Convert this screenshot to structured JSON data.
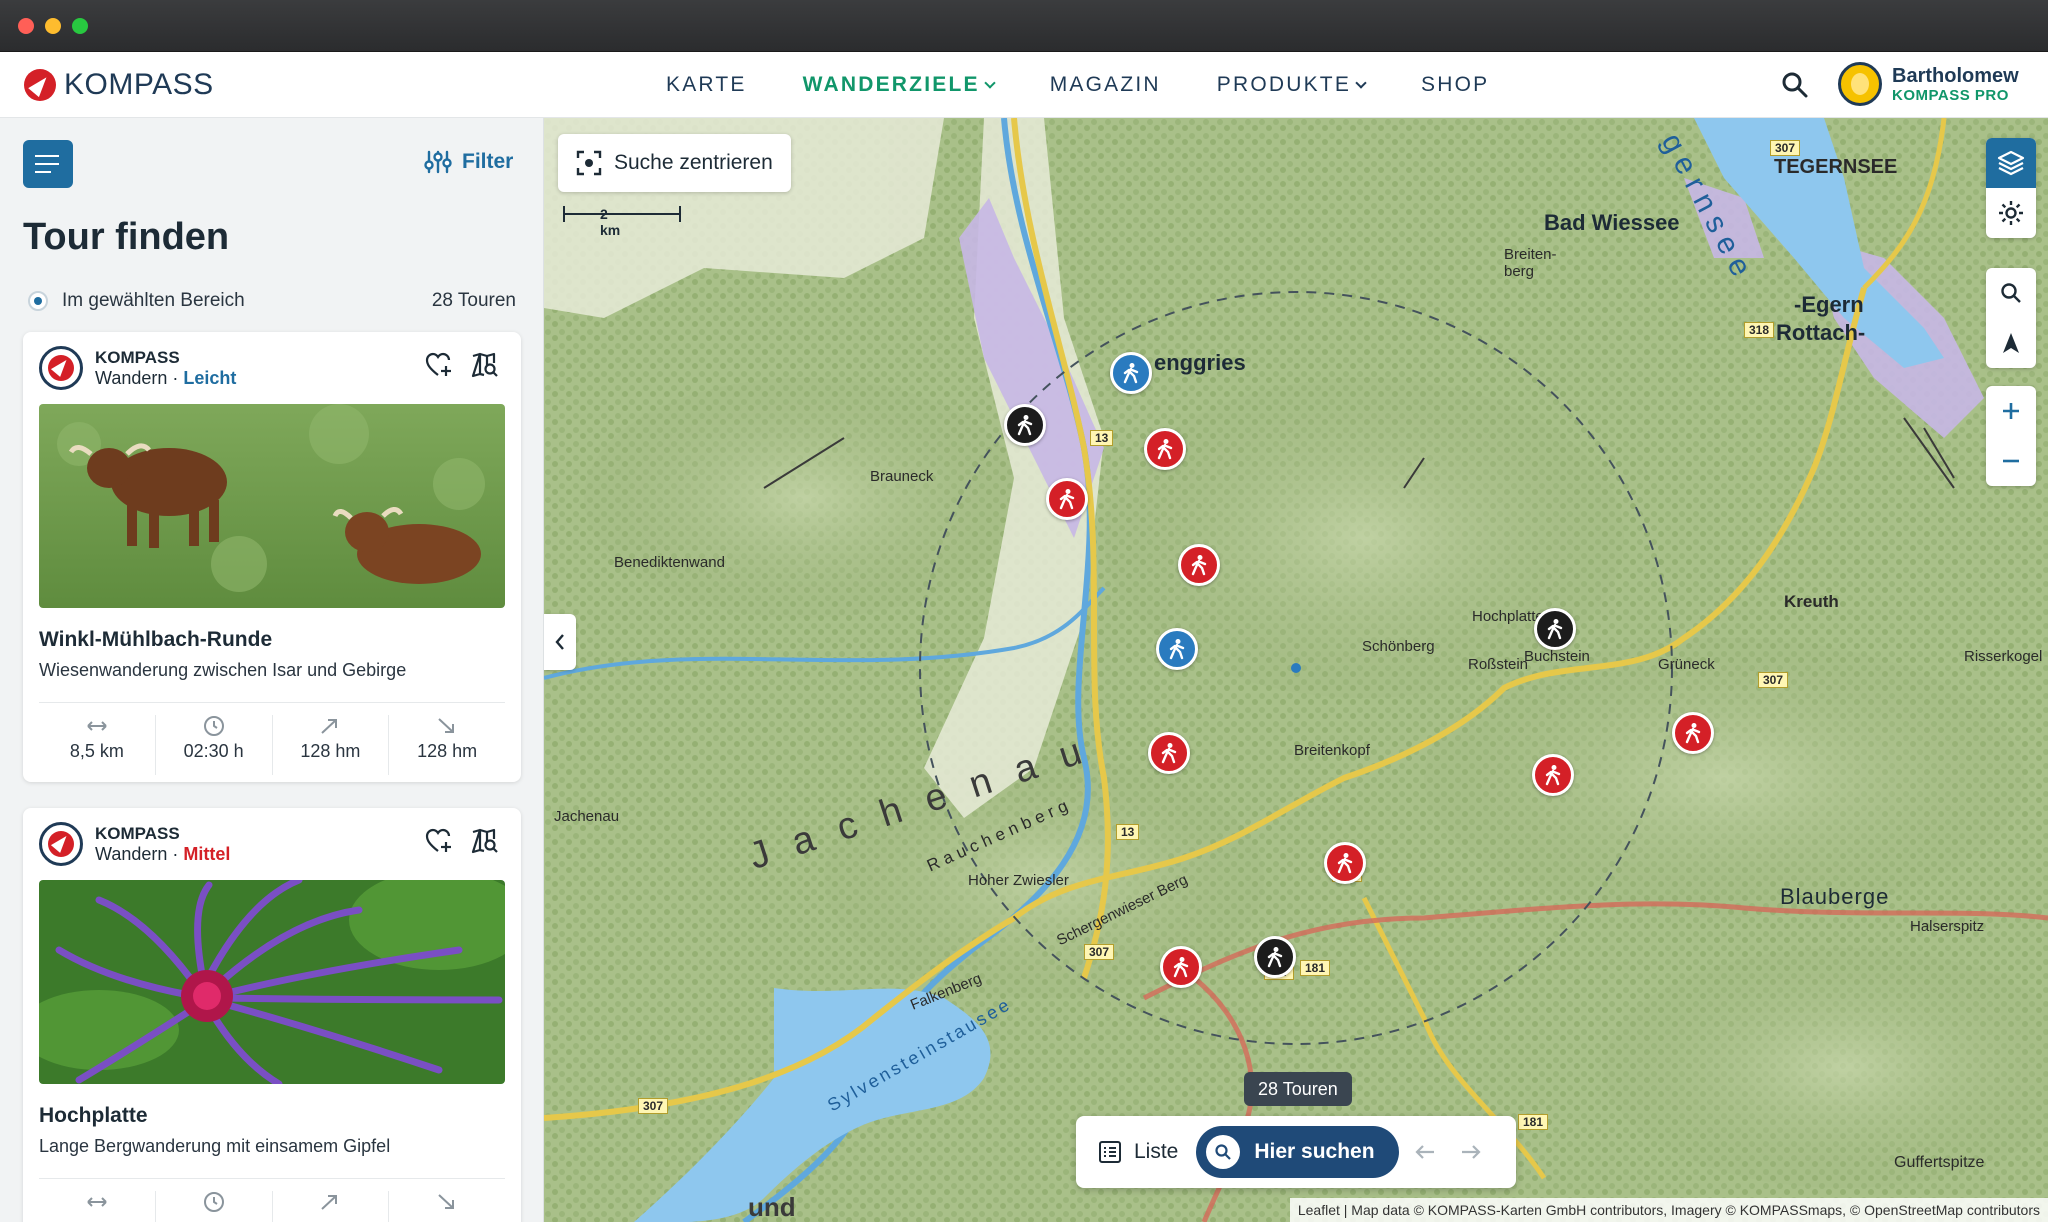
{
  "header": {
    "brand": "KOMPASS",
    "nav": [
      {
        "label": "KARTE",
        "active": false,
        "dropdown": false
      },
      {
        "label": "WANDERZIELE",
        "active": true,
        "dropdown": true
      },
      {
        "label": "MAGAZIN",
        "active": false,
        "dropdown": false
      },
      {
        "label": "PRODUKTE",
        "active": false,
        "dropdown": true
      },
      {
        "label": "SHOP",
        "active": false,
        "dropdown": false
      }
    ],
    "user": {
      "name": "Bartholomew",
      "plan": "KOMPASS PRO"
    }
  },
  "sidebar": {
    "filter_label": "Filter",
    "title": "Tour finden",
    "scope_label": "Im gewählten Bereich",
    "scope_count": "28 Touren",
    "cards": [
      {
        "brand": "KOMPASS",
        "activity": "Wandern",
        "separator": "·",
        "difficulty": "Leicht",
        "title": "Winkl-Mühlbach-Runde",
        "description": "Wiesenwanderung zwischen Isar und Gebirge",
        "stats": {
          "distance": "8,5 km",
          "duration": "02:30 h",
          "ascent": "128 hm",
          "descent": "128 hm"
        }
      },
      {
        "brand": "KOMPASS",
        "activity": "Wandern",
        "separator": "·",
        "difficulty": "Mittel",
        "title": "Hochplatte",
        "description": "Lange Bergwanderung mit einsamem Gipfel",
        "stats": {
          "distance": "",
          "duration": "",
          "ascent": "",
          "descent": ""
        }
      }
    ]
  },
  "map": {
    "center_button": "Suche zentrieren",
    "scale_label": "2 km",
    "places": {
      "tegernsee": "TEGERNSEE",
      "bad_wiessee": "Bad Wiessee",
      "egern": "-Egern",
      "rottach": "Rottach-",
      "lenggries": "enggries",
      "brauneck": "Brauneck",
      "benediktenwand": "Benediktenwand",
      "breitenberg": "Breiten-\nberg",
      "kreuth": "Kreuth",
      "risserkogel": "Risserkogel",
      "gruneck": "Grüneck",
      "hochplatte": "Hochplatte",
      "buchstein": "Buchstein",
      "schonberg": "Schönberg",
      "rossstein": "Roßstein",
      "breitenkopf": "Breitenkopf",
      "jachenau": "Jachenau",
      "jachenau_valley": "Jachenau",
      "rauchenberg": "Rauchenberg",
      "hoher_zwiesler": "Hoher Zwiesler",
      "schergenwieser": "Schergenwieser Berg",
      "falkenberg": "Falkenberg",
      "sylvenstein": "Sylvensteinstausee",
      "blauberge": "Blauberge",
      "halserspitz": "Halserspitz",
      "guffertspitze": "Guffertspitze",
      "und": "und",
      "tegernsee_lake": "gernsee"
    },
    "roads": [
      "307",
      "318",
      "13",
      "13",
      "307",
      "307",
      "307",
      "181",
      "307",
      "181",
      "307"
    ],
    "count_badge": "28 Touren",
    "list_button": "Liste",
    "search_here_button": "Hier suchen",
    "attribution": "Leaflet | Map data © KOMPASS-Karten GmbH contributors, Imagery © KOMPASSmaps, © OpenStreetMap contributors"
  },
  "colors": {
    "accent_blue": "#1f6da0",
    "accent_green": "#11966a",
    "difficulty_easy": "#1f6da0",
    "difficulty_medium": "#d42027",
    "marker_red": "#d42027",
    "marker_blue": "#2a7bbf",
    "marker_black": "#1c1c1c"
  },
  "icons": [
    "hamburger-icon",
    "filter-sliders-icon",
    "heart-plus-icon",
    "map-search-icon",
    "distance-arrows-icon",
    "clock-icon",
    "ascent-arrow-icon",
    "descent-arrow-icon",
    "center-target-icon",
    "layers-icon",
    "gear-icon",
    "search-icon",
    "navigate-arrow-icon",
    "plus-icon",
    "minus-icon",
    "list-icon",
    "chevron-left-icon",
    "arrow-left-icon",
    "arrow-right-icon",
    "hiker-icon"
  ]
}
